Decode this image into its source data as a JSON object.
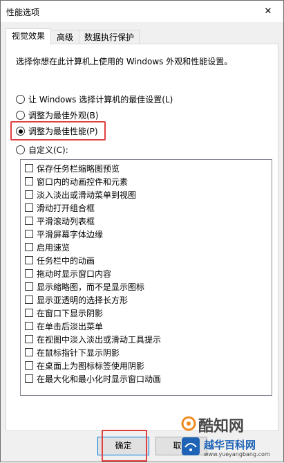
{
  "window": {
    "title": "性能选项",
    "close_glyph": "✕"
  },
  "tabs": [
    {
      "label": "视觉效果",
      "active": true
    },
    {
      "label": "高级",
      "active": false
    },
    {
      "label": "数据执行保护",
      "active": false
    }
  ],
  "description": "选择你想在此计算机上使用的 Windows 外观和性能设置。",
  "radios": [
    {
      "label": "让 Windows 选择计算机的最佳设置(L)",
      "checked": false
    },
    {
      "label": "调整为最佳外观(B)",
      "checked": false
    },
    {
      "label": "调整为最佳性能(P)",
      "checked": true
    },
    {
      "label": "自定义(C):",
      "checked": false
    }
  ],
  "effects": [
    {
      "label": "保存任务栏缩略图预览",
      "checked": false
    },
    {
      "label": "窗口内的动画控件和元素",
      "checked": false
    },
    {
      "label": "淡入淡出或滑动菜单到视图",
      "checked": false
    },
    {
      "label": "滑动打开组合框",
      "checked": false
    },
    {
      "label": "平滑滚动列表框",
      "checked": false
    },
    {
      "label": "平滑屏幕字体边缘",
      "checked": false
    },
    {
      "label": "启用速览",
      "checked": false
    },
    {
      "label": "任务栏中的动画",
      "checked": false
    },
    {
      "label": "拖动时显示窗口内容",
      "checked": false
    },
    {
      "label": "显示缩略图，而不是显示图标",
      "checked": false
    },
    {
      "label": "显示亚透明的选择长方形",
      "checked": false
    },
    {
      "label": "在窗口下显示阴影",
      "checked": false
    },
    {
      "label": "在单击后淡出菜单",
      "checked": false
    },
    {
      "label": "在视图中淡入淡出或滑动工具提示",
      "checked": false
    },
    {
      "label": "在鼠标指针下显示阴影",
      "checked": false
    },
    {
      "label": "在桌面上为图标标签使用阴影",
      "checked": false
    },
    {
      "label": "在最大化和最小化时显示窗口动画",
      "checked": false
    }
  ],
  "buttons": {
    "ok_label": "确定",
    "cancel_label": "取消"
  },
  "watermark": {
    "text": "酷知网",
    "site_text": "越华百科网",
    "url": "www.yueyangbang.com"
  },
  "colors": {
    "highlight": "#e04040",
    "accent": "#0078d7"
  }
}
